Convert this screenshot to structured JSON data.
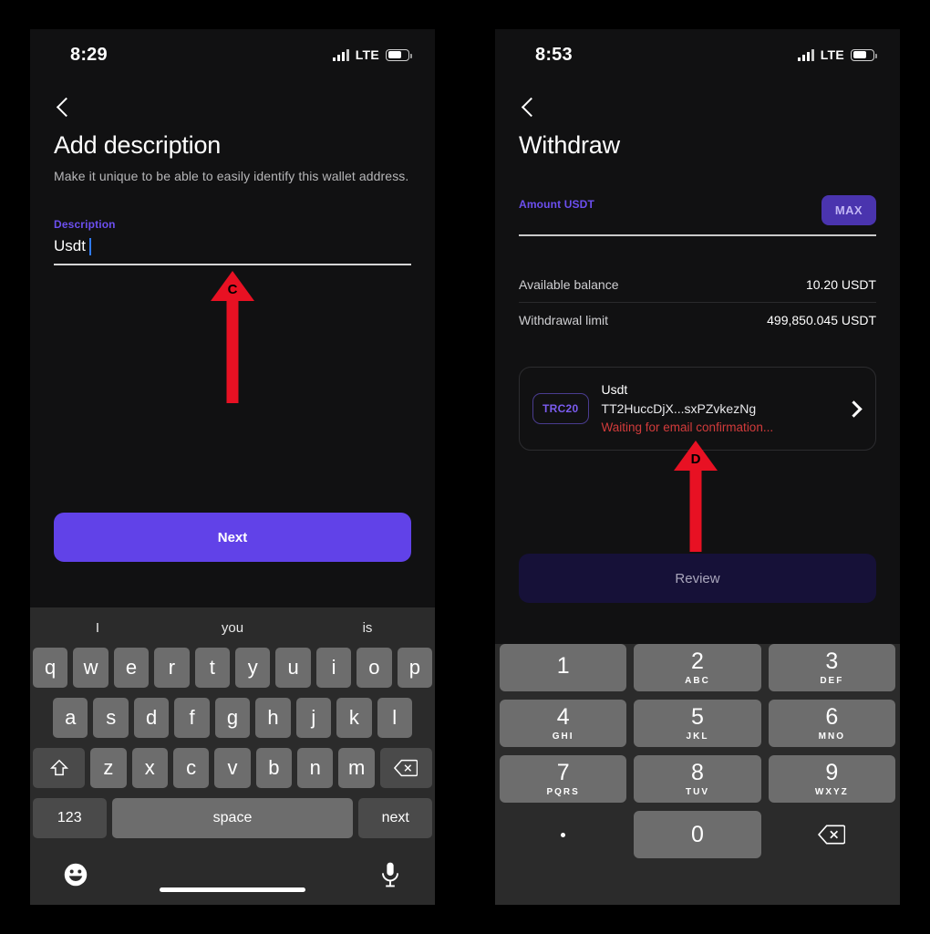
{
  "left_phone": {
    "status_bar": {
      "time": "8:29",
      "network": "LTE",
      "battery_level": "70"
    },
    "back_icon": "chevron-left-icon",
    "title": "Add description",
    "subtitle": "Make it unique to be able to easily identify this wallet address.",
    "description_field": {
      "label": "Description",
      "value": "Usdt",
      "placeholder": ""
    },
    "primary_button": "Next",
    "keyboard": {
      "suggestions": [
        "I",
        "you",
        "is"
      ],
      "row1": [
        "q",
        "w",
        "e",
        "r",
        "t",
        "y",
        "u",
        "i",
        "o",
        "p"
      ],
      "row2": [
        "a",
        "s",
        "d",
        "f",
        "g",
        "h",
        "j",
        "k",
        "l"
      ],
      "row3": [
        "z",
        "x",
        "c",
        "v",
        "b",
        "n",
        "m"
      ],
      "shift_icon": "shift-arrow-icon",
      "backspace_icon": "backspace-icon",
      "numbers_key": "123",
      "space_key": "space",
      "return_key": "next",
      "emoji_icon": "emoji-smiley-icon",
      "mic_icon": "microphone-icon"
    }
  },
  "right_phone": {
    "status_bar": {
      "time": "8:53",
      "network": "LTE",
      "battery_level": "70"
    },
    "back_icon": "chevron-left-icon",
    "title": "Withdraw",
    "amount_field": {
      "label": "Amount USDT",
      "value": "",
      "max_button": "MAX"
    },
    "info_rows": [
      {
        "key": "Available balance",
        "value": "10.20 USDT"
      },
      {
        "key": "Withdrawal limit",
        "value": "499,850.045 USDT"
      }
    ],
    "address_card": {
      "network_badge": "TRC20",
      "name": "Usdt",
      "address": "TT2HuccDjX...sxPZvkezNg",
      "status": "Waiting for email confirmation...",
      "chevron_icon": "chevron-right-icon"
    },
    "primary_button": "Review",
    "keypad": {
      "keys": [
        {
          "digit": "1",
          "letters": ""
        },
        {
          "digit": "2",
          "letters": "ABC"
        },
        {
          "digit": "3",
          "letters": "DEF"
        },
        {
          "digit": "4",
          "letters": "GHI"
        },
        {
          "digit": "5",
          "letters": "JKL"
        },
        {
          "digit": "6",
          "letters": "MNO"
        },
        {
          "digit": "7",
          "letters": "PQRS"
        },
        {
          "digit": "8",
          "letters": "TUV"
        },
        {
          "digit": "9",
          "letters": "WXYZ"
        }
      ],
      "decimal_key": ".",
      "zero_key": "0",
      "backspace_icon": "backspace-icon"
    }
  },
  "annotations": [
    {
      "label": "C",
      "color": "#e81123",
      "icon": "up-arrow-annotation"
    },
    {
      "label": "D",
      "color": "#e81123",
      "icon": "up-arrow-annotation"
    }
  ],
  "colors": {
    "accent_purple": "#6142e8",
    "label_purple": "#6c4ff0",
    "error_red": "#d23b3b",
    "annotation_red": "#e81123",
    "disabled_button": "#161138"
  }
}
